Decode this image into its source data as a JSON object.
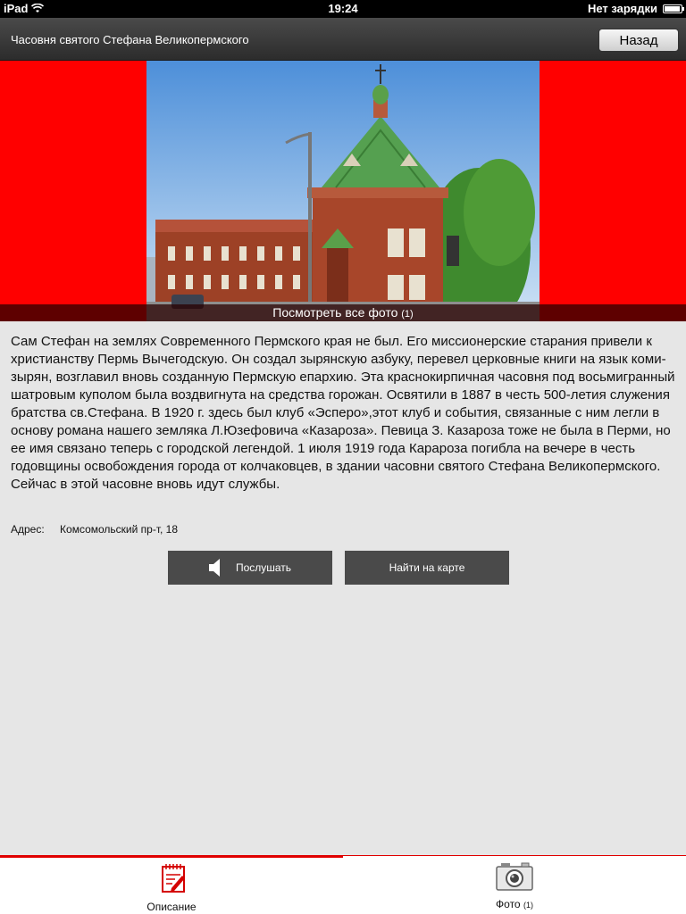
{
  "status_bar": {
    "device": "iPad",
    "time": "19:24",
    "charging": "Нет зарядки",
    "icons": [
      "wifi-icon",
      "battery-icon"
    ]
  },
  "nav": {
    "title": "Часовня святого Стефана Великопермского",
    "back_label": "Назад"
  },
  "gallery": {
    "view_all_label": "Посмотреть все фото",
    "view_all_count": "(1)",
    "background_color": "#ff0000"
  },
  "description": "Сам Стефан на землях Современного Пермского края не был. Его миссионерские старания привели к христианству Пермь Вычегодскую. Он создал зырянскую азбуку, перевел церковные книги на язык коми-зырян, возглавил вновь созданную Пермскую епархию. Эта краснокирпичная часовня под восьмигранный шатровым куполом была воздвигнута на средства горожан. Освятили в 1887 в честь 500-летия служения братства св.Стефана. В 1920 г. здесь был клуб «Эсперо»,этот клуб и события, связанные с ним легли в основу романа нашего земляка Л.Юзефовича «Казароза». Певица З. Казароза тоже не была в Перми, но ее имя связано теперь с городской легендой. 1 июля 1919 года Карароза погибла на вечере в честь годовщины освобождения города от колчаковцев, в здании часовни святого Стефана Великопермского. Сейчас в этой часовне вновь идут службы.",
  "address": {
    "label": "Адрес:",
    "value": "Комсомольский пр-т, 18"
  },
  "actions": {
    "listen_label": "Послушать",
    "listen_icon": "speaker-icon",
    "map_label": "Найти на карте"
  },
  "tabs": [
    {
      "label": "Описание",
      "count": "",
      "icon": "notepad-icon",
      "active": true
    },
    {
      "label": "Фото",
      "count": "(1)",
      "icon": "camera-icon",
      "active": false
    }
  ],
  "colors": {
    "accent": "#e00000",
    "button_bg": "#4a4a4a",
    "content_bg": "#e6e6e6"
  }
}
